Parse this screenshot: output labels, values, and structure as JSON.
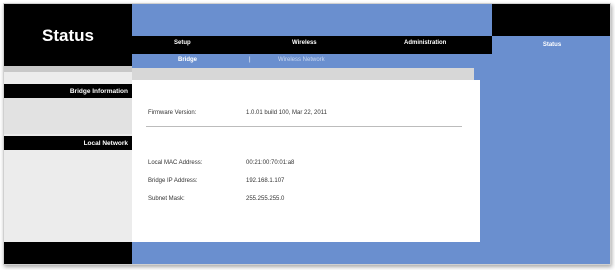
{
  "header": {
    "page_title": "Status"
  },
  "tabs": [
    {
      "label": "Setup"
    },
    {
      "label": "Wireless"
    },
    {
      "label": "Administration"
    },
    {
      "label": "Status",
      "active": true
    }
  ],
  "subtabs": [
    {
      "label": "Bridge",
      "active": true
    },
    {
      "label": "Wireless Network",
      "active": false
    }
  ],
  "sidebar": {
    "bridge_information": "Bridge Information",
    "local_network": "Local Network"
  },
  "bridge_info": {
    "firmware_label": "Firmware Version:",
    "firmware_value": "1.0.01 build 100, Mar 22, 2011"
  },
  "local_network": {
    "mac_label": "Local MAC Address:",
    "mac_value": "00:21:00:70:01:a8",
    "ip_label": "Bridge IP Address:",
    "ip_value": "192.168.1.107",
    "subnet_label": "Subnet Mask:",
    "subnet_value": "255.255.255.0"
  },
  "colors": {
    "brand_blue": "#6a8fcf",
    "black": "#000000"
  }
}
